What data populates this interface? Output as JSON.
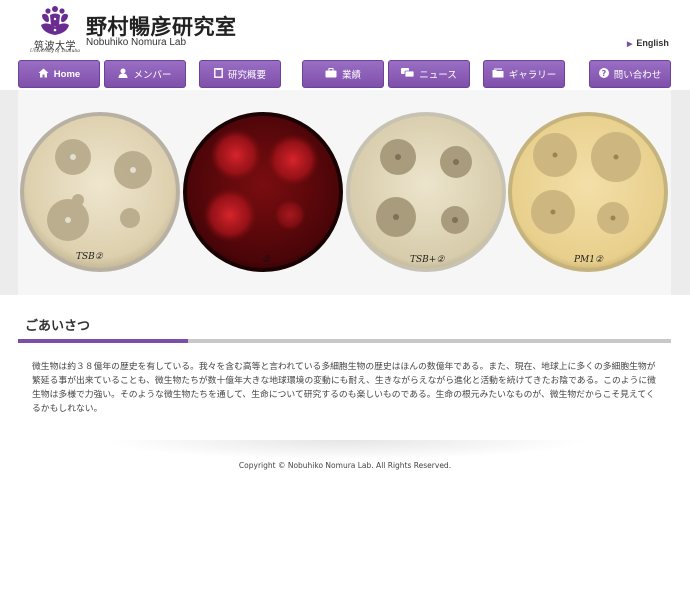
{
  "header": {
    "logo_text_jp": "筑波大学",
    "logo_text_en": "University of Tsukuba",
    "title": "野村暢彦研究室",
    "subtitle": "Nobuhiko Nomura Lab",
    "lang_link": "English"
  },
  "nav": {
    "items": [
      {
        "label": "Home",
        "icon": "home-icon"
      },
      {
        "label": "メンバー",
        "icon": "user-icon"
      },
      {
        "label": "研究概要",
        "icon": "document-icon"
      },
      {
        "label": "業績",
        "icon": "briefcase-icon"
      },
      {
        "label": "ニュース",
        "icon": "chat-icon"
      },
      {
        "label": "ギャラリー",
        "icon": "folder-icon"
      },
      {
        "label": "問い合わせ",
        "icon": "question-icon"
      }
    ]
  },
  "hero": {
    "plate_labels": [
      "TSB②",
      "②",
      "TSB+②",
      "PM1②"
    ]
  },
  "greeting": {
    "title": "ごあいさつ",
    "body": "微生物は約３８億年の歴史を有している。我々を含む高等と言われている多細胞生物の歴史はほんの数億年である。また、現在、地球上に多くの多細胞生物が繁延る事が出来ていることも、微生物たちが数十億年大きな地球環境の変動にも耐え、生きながらえながら進化と活動を続けてきたお陰である。このように微生物は多様で力強い。そのような微生物たちを通して、生命について研究するのも楽しいものである。生命の根元みたいなものが、微生物だからこそ見えてくるかもしれない。"
  },
  "footer": {
    "copyright": "Copyright © Nobuhiko Nomura Lab. All Rights Reserved."
  },
  "colors": {
    "accent": "#7b4fa8",
    "nav_bg": "#8a5bb6",
    "rule_gray": "#c8c8c8"
  }
}
